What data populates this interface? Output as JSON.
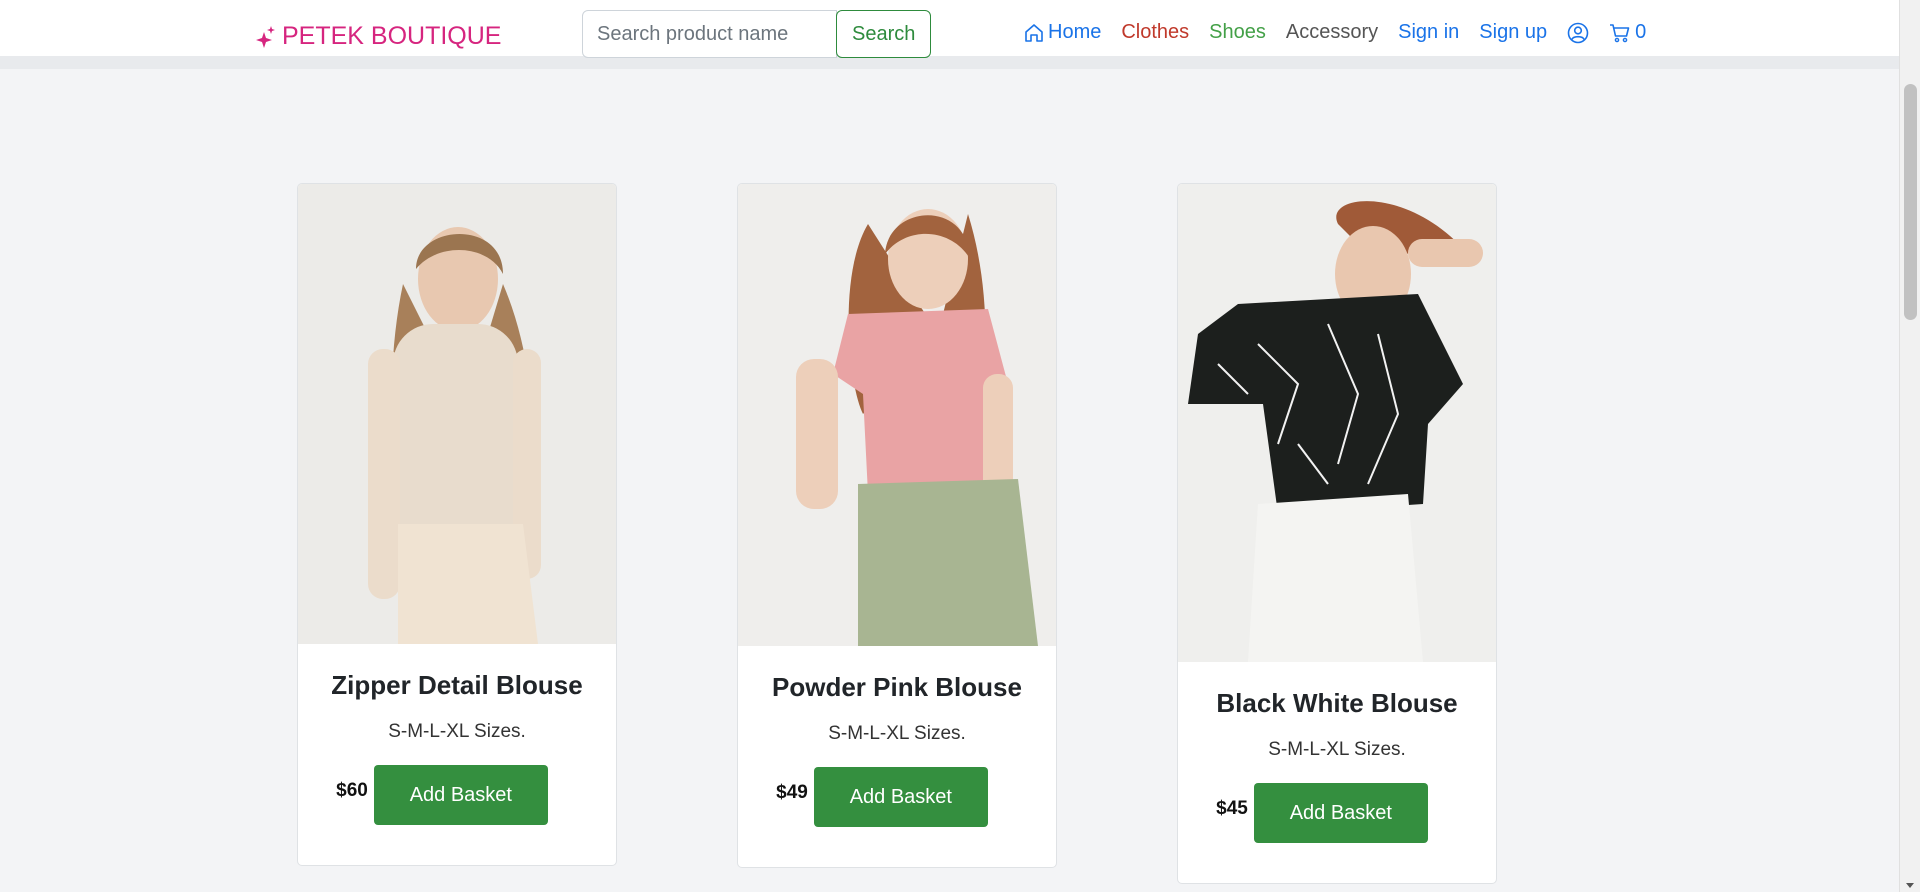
{
  "brand": {
    "name": "PETEK BOUTIQUE",
    "icon": "sparkle-icon"
  },
  "search": {
    "placeholder": "Search product name",
    "button_label": "Search"
  },
  "nav": {
    "home": "Home",
    "clothes": "Clothes",
    "shoes": "Shoes",
    "accessory": "Accessory",
    "sign_in": "Sign in",
    "sign_up": "Sign up",
    "cart_count": "0"
  },
  "products": [
    {
      "title": "Zipper Detail Blouse",
      "sizes": "S-M-L-XL Sizes.",
      "price": "$60",
      "button": "Add Basket",
      "top_color": "#e8dccd",
      "body_color": "#f0e3d2"
    },
    {
      "title": "Powder Pink Blouse",
      "sizes": "S-M-L-XL Sizes.",
      "price": "$49",
      "button": "Add Basket",
      "top_color": "#e9a3a4",
      "body_color": "#a8b592"
    },
    {
      "title": "Black White Blouse",
      "sizes": "S-M-L-XL Sizes.",
      "price": "$45",
      "button": "Add Basket",
      "top_color": "#1c1f1d",
      "body_color": "#f4f4f2"
    }
  ]
}
